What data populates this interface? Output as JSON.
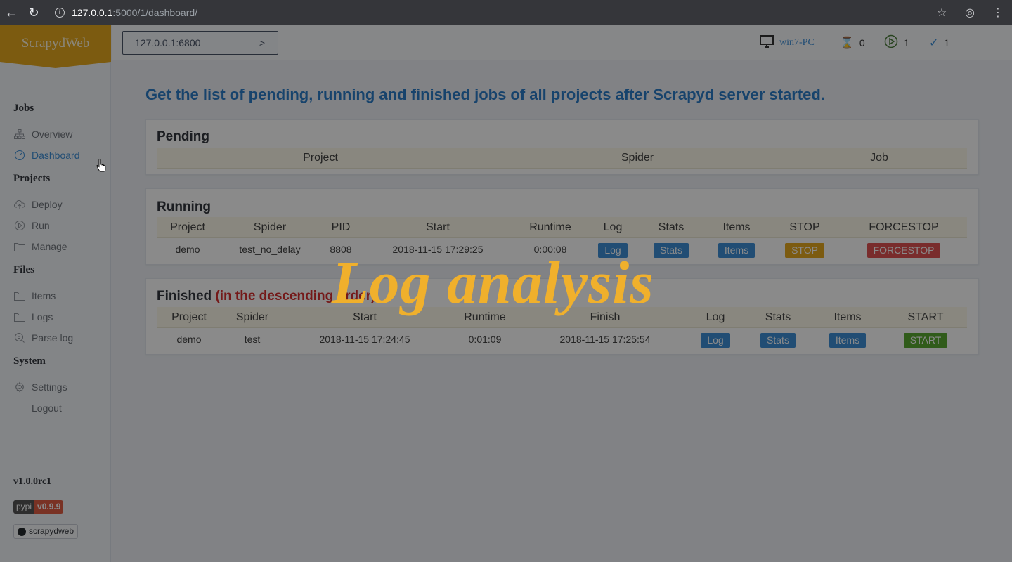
{
  "browser": {
    "url_host": "127.0.0.1",
    "url_path": ":5000/1/dashboard/"
  },
  "sidebar": {
    "logo": "ScrapydWeb",
    "sections": [
      {
        "title": "Jobs",
        "items": [
          {
            "label": "Overview",
            "icon": "sitemap-icon"
          },
          {
            "label": "Dashboard",
            "icon": "dashboard-icon",
            "active": true
          }
        ]
      },
      {
        "title": "Projects",
        "items": [
          {
            "label": "Deploy",
            "icon": "upload-cloud-icon"
          },
          {
            "label": "Run",
            "icon": "play-circle-icon"
          },
          {
            "label": "Manage",
            "icon": "folder-icon"
          }
        ]
      },
      {
        "title": "Files",
        "items": [
          {
            "label": "Items",
            "icon": "folder-icon"
          },
          {
            "label": "Logs",
            "icon": "folder-icon"
          },
          {
            "label": "Parse log",
            "icon": "search-doc-icon"
          }
        ]
      },
      {
        "title": "System",
        "items": [
          {
            "label": "Settings",
            "icon": "gear-icon"
          },
          {
            "label": "Logout",
            "icon": ""
          }
        ]
      }
    ],
    "version": "v1.0.0rc1",
    "pypi_label": "pypi",
    "pypi_version": "v0.9.9",
    "github_label": "scrapydweb"
  },
  "topbar": {
    "server": "127.0.0.1:6800",
    "host_name": "win7-PC",
    "pending_count": "0",
    "running_count": "1",
    "finished_count": "1"
  },
  "main": {
    "headline": "Get the list of pending, running and finished jobs of all projects after Scrapyd server started.",
    "pending": {
      "title": "Pending",
      "columns": [
        "Project",
        "Spider",
        "Job"
      ]
    },
    "running": {
      "title": "Running",
      "columns": [
        "Project",
        "Spider",
        "PID",
        "Start",
        "Runtime",
        "Log",
        "Stats",
        "Items",
        "STOP",
        "FORCESTOP"
      ],
      "rows": [
        {
          "project": "demo",
          "spider": "test_no_delay",
          "pid": "8808",
          "start": "2018-11-15 17:29:25",
          "runtime": "0:00:08",
          "log": "Log",
          "stats": "Stats",
          "items": "Items",
          "stop": "STOP",
          "forcestop": "FORCESTOP"
        }
      ]
    },
    "finished": {
      "title": "Finished",
      "note": "(in the descending order)",
      "columns": [
        "Project",
        "Spider",
        "Start",
        "Runtime",
        "Finish",
        "Log",
        "Stats",
        "Items",
        "START"
      ],
      "rows": [
        {
          "project": "demo",
          "spider": "test",
          "start": "2018-11-15 17:24:45",
          "runtime": "0:01:09",
          "finish": "2018-11-15 17:25:54",
          "log": "Log",
          "stats": "Stats",
          "items": "Items",
          "start_btn": "START"
        }
      ]
    }
  },
  "overlay": {
    "banner": "Log analysis"
  }
}
